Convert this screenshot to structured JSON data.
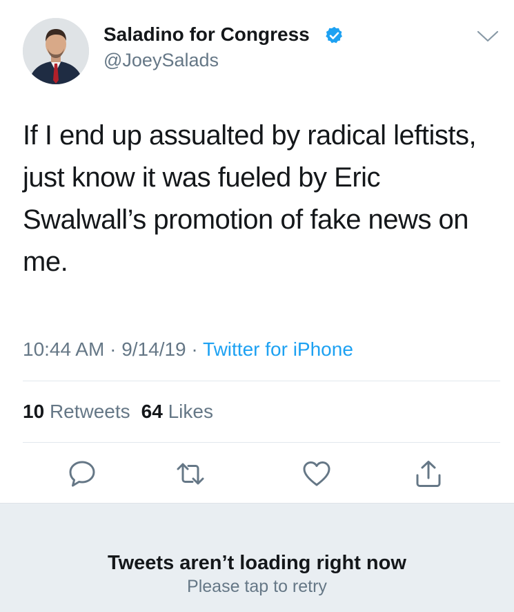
{
  "author": {
    "display_name": "Saladino for Congress",
    "handle": "@JoeySalads",
    "verified": true
  },
  "tweet": {
    "text": "If I end up assualted by radical leftists, just know it was fueled by Eric Swalwall’s promotion of fake news on me.",
    "time": "10:44 AM",
    "separator": " · ",
    "date": "9/14/19",
    "source": "Twitter for iPhone"
  },
  "stats": {
    "retweets_count": "10",
    "retweets_label": "Retweets",
    "likes_count": "64",
    "likes_label": "Likes"
  },
  "error": {
    "title": "Tweets aren’t loading right now",
    "subtitle": "Please tap to retry"
  },
  "colors": {
    "text": "#14171a",
    "secondary": "#657786",
    "link": "#1da1f2",
    "divider": "#e1e8ed",
    "panel": "#e9eef2"
  }
}
